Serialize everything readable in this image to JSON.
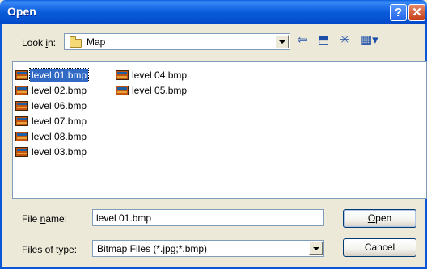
{
  "window": {
    "title": "Open",
    "help_glyph": "?",
    "close_glyph": "✕"
  },
  "lookin": {
    "label_pre": "Look ",
    "label_key": "i",
    "label_post": "n:",
    "value": "Map"
  },
  "files": [
    {
      "name": "level 01.bmp",
      "selected": true
    },
    {
      "name": "level 02.bmp",
      "selected": false
    },
    {
      "name": "level 06.bmp",
      "selected": false
    },
    {
      "name": "level 07.bmp",
      "selected": false
    },
    {
      "name": "level 08.bmp",
      "selected": false
    },
    {
      "name": "level  03.bmp",
      "selected": false
    },
    {
      "name": "level  04.bmp",
      "selected": false
    },
    {
      "name": "level  05.bmp",
      "selected": false
    }
  ],
  "filename": {
    "label_pre": "File ",
    "label_key": "n",
    "label_post": "ame:",
    "value": "level 01.bmp"
  },
  "filetype": {
    "label_pre": "Files of ",
    "label_key": "t",
    "label_post": "ype:",
    "value": "Bitmap Files (*.jpg;*.bmp)"
  },
  "buttons": {
    "open_key": "O",
    "open_rest": "pen",
    "cancel": "Cancel"
  },
  "toolbar": {
    "back_glyph": "⇦",
    "up_glyph": "⬒",
    "newfolder_glyph": "✳",
    "views_glyph": "▦▾"
  }
}
